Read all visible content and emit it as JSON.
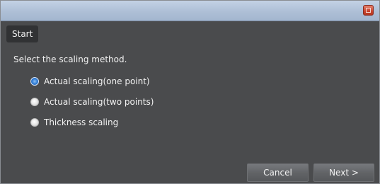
{
  "titlebar": {
    "close_icon": "close-icon",
    "accent": "#c9432e"
  },
  "step": {
    "label": "Start"
  },
  "instruction": "Select the scaling method.",
  "options": [
    {
      "label": "Actual scaling(one point)",
      "selected": true
    },
    {
      "label": "Actual scaling(two points)",
      "selected": false
    },
    {
      "label": "Thickness scaling",
      "selected": false
    }
  ],
  "buttons": {
    "cancel_label": "Cancel",
    "next_label": "Next >"
  }
}
